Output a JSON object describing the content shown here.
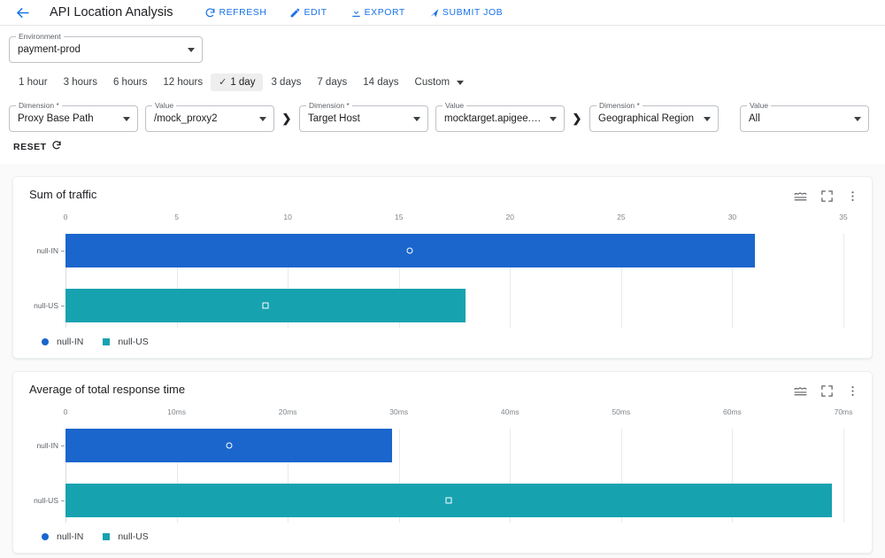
{
  "header": {
    "back_icon": "arrow-left-icon",
    "title": "API Location Analysis",
    "actions": [
      {
        "label": "REFRESH",
        "icon": "refresh-icon"
      },
      {
        "label": "EDIT",
        "icon": "pencil-icon"
      },
      {
        "label": "EXPORT",
        "icon": "download-icon"
      },
      {
        "label": "SUBMIT JOB",
        "icon": "send-icon"
      }
    ],
    "accent": "#1a73e8"
  },
  "environment": {
    "label": "Environment",
    "value": "payment-prod"
  },
  "time_range": {
    "options": [
      "1 hour",
      "3 hours",
      "6 hours",
      "12 hours",
      "1 day",
      "3 days",
      "7 days",
      "14 days",
      "Custom"
    ],
    "selected": "1 day",
    "check_glyph": "✓",
    "custom_has_caret": true
  },
  "filters": [
    {
      "label": "Dimension *",
      "value": "Proxy Base Path"
    },
    {
      "label": "Value",
      "value": "/mock_proxy2"
    },
    {
      "label": "Dimension *",
      "value": "Target Host"
    },
    {
      "label": "Value",
      "value": "mocktarget.apigee.net"
    },
    {
      "label": "Dimension *",
      "value": "Geographical Region"
    },
    {
      "label": "Value",
      "value": "All"
    }
  ],
  "separator_glyph": "❯",
  "reset": {
    "label": "RESET",
    "icon": "refresh-icon"
  },
  "card_icons": [
    {
      "name": "chart-type-icon"
    },
    {
      "name": "fullscreen-icon"
    },
    {
      "name": "more-vert-icon"
    }
  ],
  "colors": {
    "series_in": "#1a66cc",
    "series_us": "#17a2b0",
    "grid": "#e8eaed",
    "tick_text": "#80868b"
  },
  "chart_data": [
    {
      "type": "bar",
      "orientation": "horizontal",
      "title": "Sum of traffic",
      "xlabel": "",
      "ylabel": "",
      "xlim": [
        0,
        35
      ],
      "xticks": [
        0,
        5,
        10,
        15,
        20,
        25,
        30,
        35
      ],
      "xtick_labels": [
        "0",
        "5",
        "10",
        "15",
        "20",
        "25",
        "30",
        "35"
      ],
      "categories": [
        "null-IN",
        "null-US"
      ],
      "grid": true,
      "legend_position": "bottom-left",
      "series": [
        {
          "name": "null-IN",
          "values": [
            31
          ],
          "color": "#1a66cc",
          "marker": "circle"
        },
        {
          "name": "null-US",
          "values": [
            18
          ],
          "color": "#17a2b0",
          "marker": "square"
        }
      ],
      "bars": [
        {
          "category": "null-IN",
          "value": 31,
          "color": "#1a66cc",
          "marker": "circle"
        },
        {
          "category": "null-US",
          "value": 18,
          "color": "#17a2b0",
          "marker": "square"
        }
      ]
    },
    {
      "type": "bar",
      "orientation": "horizontal",
      "title": "Average of total response time",
      "xlabel": "",
      "ylabel": "",
      "xlim": [
        0,
        70
      ],
      "xticks": [
        0,
        10,
        20,
        30,
        40,
        50,
        60,
        70
      ],
      "xtick_labels": [
        "0",
        "10ms",
        "20ms",
        "30ms",
        "40ms",
        "50ms",
        "60ms",
        "70ms"
      ],
      "categories": [
        "null-IN",
        "null-US"
      ],
      "grid": true,
      "legend_position": "bottom-left",
      "series": [
        {
          "name": "null-IN",
          "values": [
            29.4
          ],
          "color": "#1a66cc",
          "marker": "circle"
        },
        {
          "name": "null-US",
          "values": [
            69
          ],
          "color": "#17a2b0",
          "marker": "square"
        }
      ],
      "bars": [
        {
          "category": "null-IN",
          "value": 29.4,
          "color": "#1a66cc",
          "marker": "circle"
        },
        {
          "category": "null-US",
          "value": 69,
          "color": "#17a2b0",
          "marker": "square"
        }
      ]
    }
  ]
}
